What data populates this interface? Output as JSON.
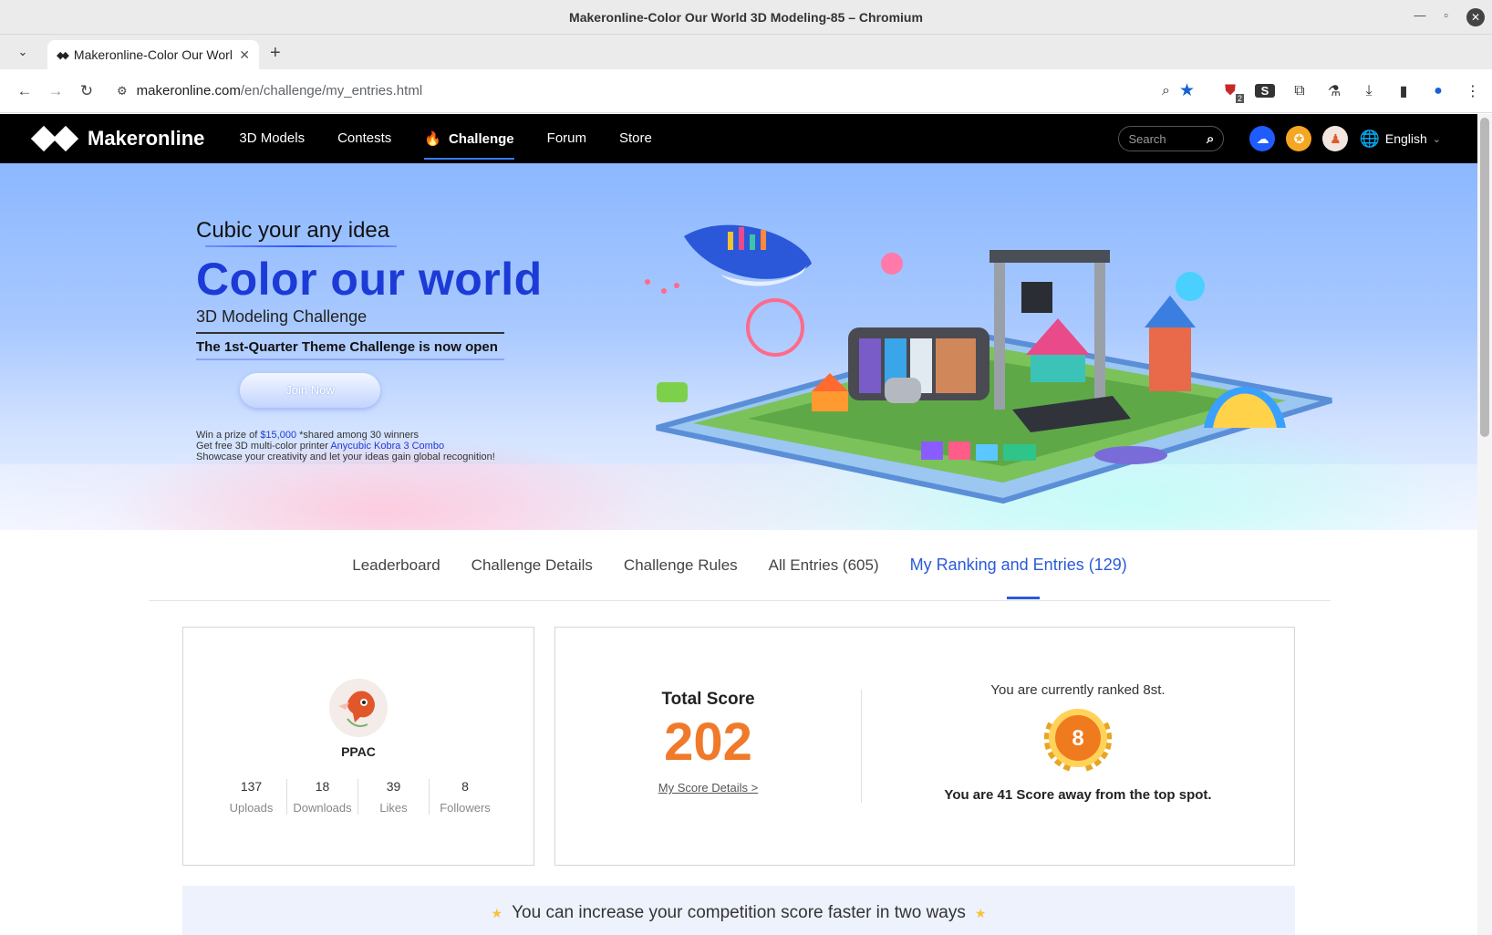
{
  "browser": {
    "window_title": "Makeronline-Color Our World 3D Modeling-85 – Chromium",
    "tab_title": "Makeronline-Color Our World 3D Modeling-85",
    "url_host": "makeronline.com",
    "url_path": "/en/challenge/my_entries.html",
    "ext_badge": "2"
  },
  "nav": {
    "brand": "Makeronline",
    "items": [
      "3D Models",
      "Contests",
      "Challenge",
      "Forum",
      "Store"
    ],
    "search_placeholder": "Search",
    "language": "English"
  },
  "banner": {
    "tagline": "Cubic your any idea",
    "headline": "Color our world",
    "subtitle": "3D Modeling Challenge",
    "theme_line": "The 1st-Quarter Theme Challenge is now open",
    "join_label": "Join Now",
    "prize_pre": "Win a prize of ",
    "prize_amount": "$15,000",
    "prize_post": " *shared among 30 winners",
    "printer_pre": "Get free 3D multi-color printer ",
    "printer_name": "Anycubic Kobra 3 Combo",
    "showcase": "Showcase your creativity and let your ideas gain global recognition!"
  },
  "tabs": [
    "Leaderboard",
    "Challenge Details",
    "Challenge Rules",
    "All Entries (605)",
    "My Ranking and Entries (129)"
  ],
  "profile": {
    "name": "PPAC",
    "stats": [
      {
        "value": "137",
        "label": "Uploads"
      },
      {
        "value": "18",
        "label": "Downloads"
      },
      {
        "value": "39",
        "label": "Likes"
      },
      {
        "value": "8",
        "label": "Followers"
      }
    ]
  },
  "score": {
    "label": "Total Score",
    "value": "202",
    "details_link": "My Score Details >",
    "rank_text": "You are currently ranked 8st.",
    "rank_number": "8",
    "away_text": "You are 41 Score away from the top spot."
  },
  "tip": {
    "text": "You can increase your competition score faster in two ways"
  },
  "colors": {
    "accent": "#2a5ad8",
    "score": "#f07a2a",
    "headline": "#1c3bd6"
  }
}
